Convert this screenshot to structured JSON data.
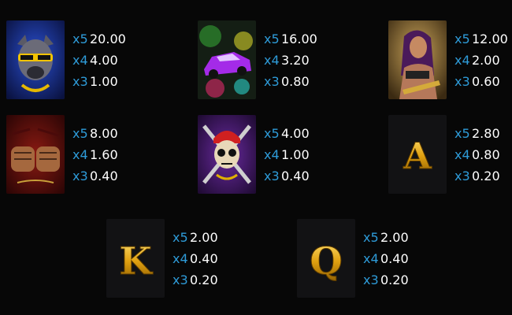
{
  "colors": {
    "multiplier": "#2e9bd8",
    "value": "#ffffff",
    "background": "#070707"
  },
  "symbols": [
    {
      "icon": "pitbull-dog-icon",
      "pays": [
        {
          "mult": "x5",
          "value": "20.00"
        },
        {
          "mult": "x4",
          "value": "4.00"
        },
        {
          "mult": "x3",
          "value": "1.00"
        }
      ]
    },
    {
      "icon": "purple-sports-car-icon",
      "pays": [
        {
          "mult": "x5",
          "value": "16.00"
        },
        {
          "mult": "x4",
          "value": "3.20"
        },
        {
          "mult": "x3",
          "value": "0.80"
        }
      ]
    },
    {
      "icon": "woman-with-gun-icon",
      "pays": [
        {
          "mult": "x5",
          "value": "12.00"
        },
        {
          "mult": "x4",
          "value": "2.00"
        },
        {
          "mult": "x3",
          "value": "0.60"
        }
      ]
    },
    {
      "icon": "tattooed-fists-icon",
      "pays": [
        {
          "mult": "x5",
          "value": "8.00"
        },
        {
          "mult": "x4",
          "value": "1.60"
        },
        {
          "mult": "x3",
          "value": "0.40"
        }
      ]
    },
    {
      "icon": "skull-with-bats-icon",
      "pays": [
        {
          "mult": "x5",
          "value": "4.00"
        },
        {
          "mult": "x4",
          "value": "1.00"
        },
        {
          "mult": "x3",
          "value": "0.40"
        }
      ]
    },
    {
      "icon": "letter-a-icon",
      "letter": "A",
      "pays": [
        {
          "mult": "x5",
          "value": "2.80"
        },
        {
          "mult": "x4",
          "value": "0.80"
        },
        {
          "mult": "x3",
          "value": "0.20"
        }
      ]
    },
    {
      "icon": "letter-k-icon",
      "letter": "K",
      "pays": [
        {
          "mult": "x5",
          "value": "2.00"
        },
        {
          "mult": "x4",
          "value": "0.40"
        },
        {
          "mult": "x3",
          "value": "0.20"
        }
      ]
    },
    {
      "icon": "letter-q-icon",
      "letter": "Q",
      "pays": [
        {
          "mult": "x5",
          "value": "2.00"
        },
        {
          "mult": "x4",
          "value": "0.40"
        },
        {
          "mult": "x3",
          "value": "0.20"
        }
      ]
    }
  ]
}
